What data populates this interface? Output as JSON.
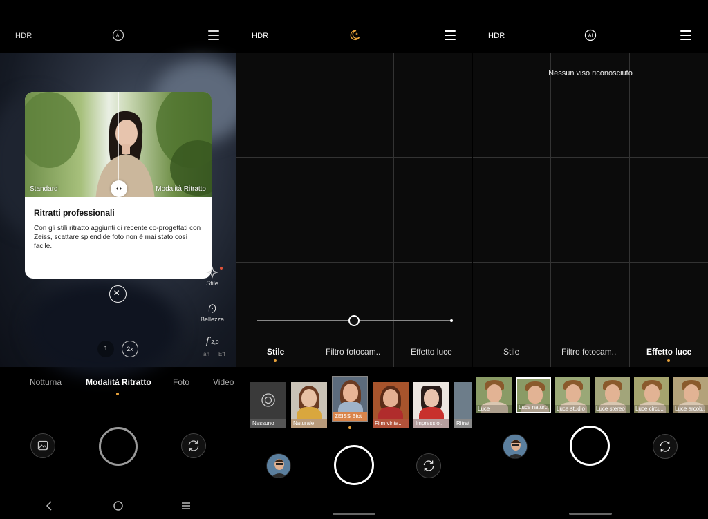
{
  "panel1": {
    "hdr": "HDR",
    "center_icon": "ai-icon",
    "card": {
      "left_label": "Standard",
      "right_label": "Modalità Ritratto",
      "title": "Ritratti professionali",
      "body": "Con gli stili ritratto aggiunti di recente co-progettati con Zeiss, scattare splendide foto non è mai stato così facile."
    },
    "side": {
      "stile": "Stile",
      "bellezza": "Bellezza",
      "aperture": "2,0",
      "partial_left": "ah",
      "partial_right": "Eff"
    },
    "zoom": [
      "1",
      "2x"
    ],
    "modes": [
      "Notturna",
      "Modalità Ritratto",
      "Foto",
      "Video"
    ],
    "active_mode": "Modalità Ritratto"
  },
  "panel2": {
    "hdr": "HDR",
    "center_icon": "night-moon-icon",
    "tabs": [
      "Stile",
      "Filtro fotocam..",
      "Effetto luce"
    ],
    "active_tab": "Stile",
    "slider_value": 0.5,
    "filters": [
      "Nessuno",
      "Naturale",
      "ZEISS Biot",
      "Film vinta..",
      "Impressio..",
      "Ritrat"
    ],
    "selected_filter": "ZEISS Biot"
  },
  "panel3": {
    "hdr": "HDR",
    "center_icon": "ai-icon",
    "notice": "Nessun viso riconosciuto",
    "tabs": [
      "Stile",
      "Filtro fotocam..",
      "Effetto luce"
    ],
    "active_tab": "Effetto luce",
    "lights": [
      "Luce",
      "Luce natur..",
      "Luce studio",
      "Luce stereo",
      "Luce circu..",
      "Luce arcob.."
    ],
    "selected_light": "Luce natur.."
  },
  "colors": {
    "accent": "#e8a23a",
    "background": "#000000"
  }
}
